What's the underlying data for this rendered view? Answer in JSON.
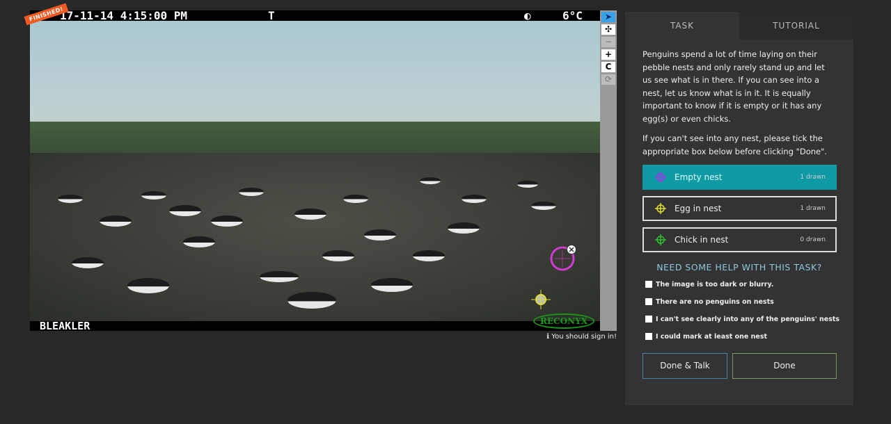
{
  "viewer": {
    "badge": "FINISHED!",
    "timestamp": "17-11-14 4:15:00 PM",
    "temp_marker": "T",
    "moon": "◐",
    "temperature": "6°C",
    "camera_name": "BLEAKLER",
    "brand": "RECONYX"
  },
  "toolbar": [
    {
      "name": "pointer",
      "glyph": "➤"
    },
    {
      "name": "pan",
      "glyph": "✣"
    },
    {
      "name": "zoom-out",
      "glyph": "−"
    },
    {
      "name": "zoom-in",
      "glyph": "+"
    },
    {
      "name": "rotate",
      "glyph": "C"
    },
    {
      "name": "reset",
      "glyph": "⟳"
    }
  ],
  "signin": {
    "icon": "ℹ",
    "text": "You should sign in!"
  },
  "panel": {
    "tabs": [
      "TASK",
      "TUTORIAL"
    ],
    "description": [
      "Penguins spend a lot of time laying on their pebble nests and only rarely stand up and let us see what is in there. If you can see into a nest, let us know what is in it. It is equally important to know if it is empty or it has any egg(s) or even chicks.",
      "If you can't see into any nest, please tick the appropriate box below before clicking \"Done\"."
    ],
    "tools": [
      {
        "label": "Empty nest",
        "count": "1 drawn",
        "color": "#7b4fd6"
      },
      {
        "label": "Egg in nest",
        "count": "1 drawn",
        "color": "#e0e030"
      },
      {
        "label": "Chick in nest",
        "count": "0 drawn",
        "color": "#30c030"
      }
    ],
    "help_title": "NEED SOME HELP WITH THIS TASK?",
    "checkboxes": [
      "The image is too dark or blurry.",
      "There are no penguins on nests",
      "I can't see clearly into any of the penguins' nests",
      "I could mark at least one nest"
    ],
    "done_talk": "Done & Talk",
    "done": "Done"
  }
}
